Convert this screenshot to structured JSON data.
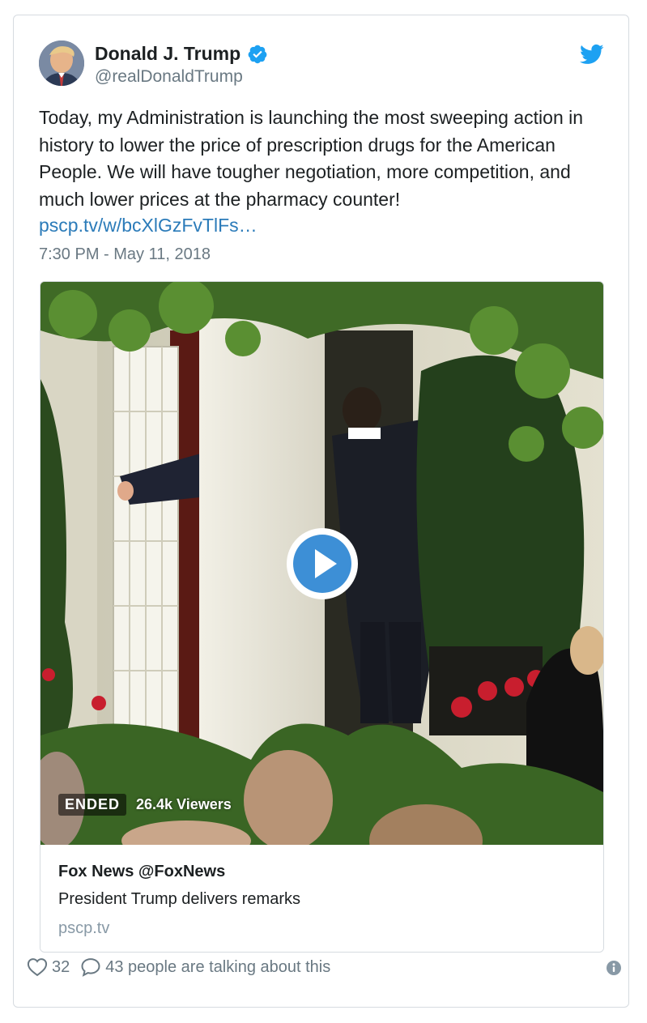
{
  "author": {
    "name": "Donald J. Trump",
    "handle": "@realDonaldTrump",
    "verified": true
  },
  "tweet": {
    "text": "Today, my Administration is launching the most sweeping action in history to lower the price of prescription drugs for the American People. We will have tougher negotiation, more competition, and much lower prices at the pharmacy counter!",
    "link": "pscp.tv/w/bcXlGzFvTlFs…",
    "timestamp": "7:30 PM - May 11, 2018"
  },
  "media": {
    "status": "ENDED",
    "viewers": "26.4k Viewers",
    "source": "Fox News @FoxNews",
    "title": "President Trump delivers remarks",
    "domain": "pscp.tv"
  },
  "footer": {
    "like_count": "32",
    "talking_text": "43 people are talking about this"
  },
  "icons": {
    "verified": "verified-badge-icon",
    "brand": "twitter-bird-icon",
    "play": "play-icon",
    "like": "heart-icon",
    "reply": "speech-bubble-icon",
    "info": "info-icon"
  },
  "colors": {
    "twitter_blue": "#1da1f2",
    "link_blue": "#2b7bb9",
    "muted_gray": "#697882",
    "border": "#d6dbe0",
    "play_blue": "#3d8fd6"
  }
}
